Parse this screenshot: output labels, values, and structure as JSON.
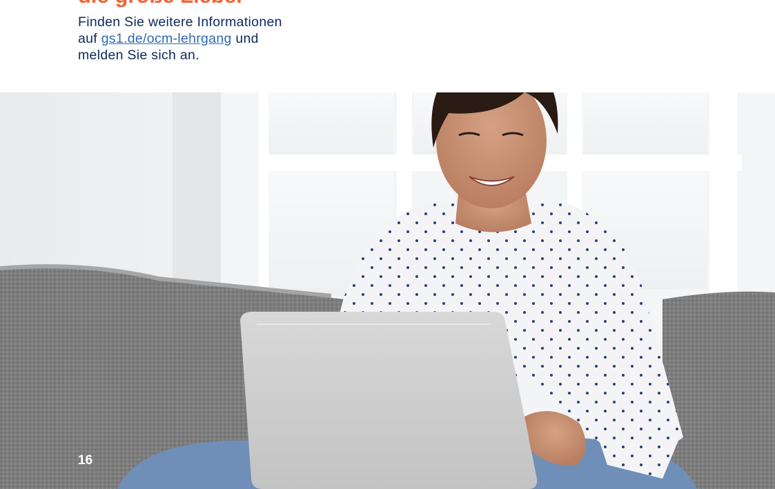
{
  "heading": {
    "text": "die große Liebe."
  },
  "info": {
    "line1": "Finden Sie weitere Informationen",
    "line2_prefix": "auf ",
    "link": "gs1.de/ocm-lehrgang",
    "line2_suffix": " und",
    "line3": "melden Sie sich an."
  },
  "colors": {
    "heading": "#f26334",
    "body_text": "#0a2a5c",
    "link": "#2f69b3",
    "page_number": "#ffffff"
  },
  "photo": {
    "description_icon": "woman-with-laptop-photo"
  },
  "page_number": "16"
}
